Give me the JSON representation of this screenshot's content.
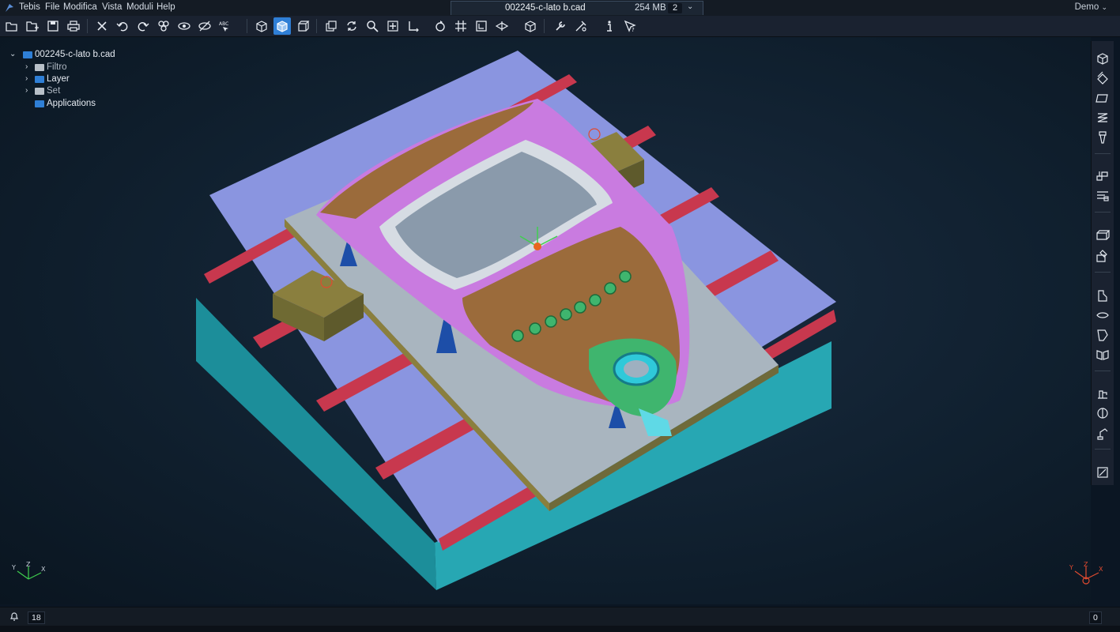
{
  "app": {
    "name": "Tebis",
    "logo_icon": "tebis-logo-icon"
  },
  "menu": [
    "Tebis",
    "File",
    "Modifica",
    "Vista",
    "Moduli",
    "Help"
  ],
  "document_tab": {
    "filename": "002245-c-lato b.cad",
    "memory": "254 MB",
    "window_count": "2"
  },
  "user_menu": "Demo",
  "toolbar": [
    "open-file-icon",
    "open-folder-icon",
    "save-icon",
    "print-icon",
    "delete-icon",
    "undo-icon",
    "redo-icon",
    "select-elements-icon",
    "show-icon",
    "hide-icon",
    "text-select-icon",
    "view-iso-icon",
    "view-shaded-icon",
    "view-wireframe-icon",
    "view-layers-icon",
    "refresh-icon",
    "zoom-icon",
    "pan-icon",
    "axis-icon",
    "rotate-icon",
    "grid-icon",
    "frame-icon",
    "view-direction-icon",
    "cube-3d-icon",
    "tools-icon",
    "measure-icon",
    "info-icon",
    "pointer-help-icon"
  ],
  "active_tool": "view-shaded-icon",
  "tree": {
    "root": "002245-c-lato b.cad",
    "children": [
      "Filtro",
      "Layer",
      "Set",
      "Applications"
    ]
  },
  "right_toolbar": [
    "box-solid-icon",
    "sheets-icon",
    "plane-icon",
    "zigzag-path-icon",
    "drill-tool-icon",
    "machining-icon",
    "layers-stack-icon",
    "box-open-icon",
    "box-edit-icon",
    "fixture-icon",
    "surface-icon",
    "shape-icon",
    "mirror-icon",
    "machine-icon",
    "head-icon",
    "settings-robot-icon",
    "export-icon"
  ],
  "status": {
    "notifications": "18",
    "messages": "0"
  },
  "colors": {
    "table_top": "#8a95e0",
    "table_side": "#27a7b3",
    "slot": "#c8384e",
    "base_plate": "#a9b5bf",
    "fixture": "#8a7f3e",
    "part_pink": "#c97be0",
    "part_bronze": "#9b6b3b",
    "boss_green": "#3fb56e",
    "selection": "#2f7fd6"
  }
}
